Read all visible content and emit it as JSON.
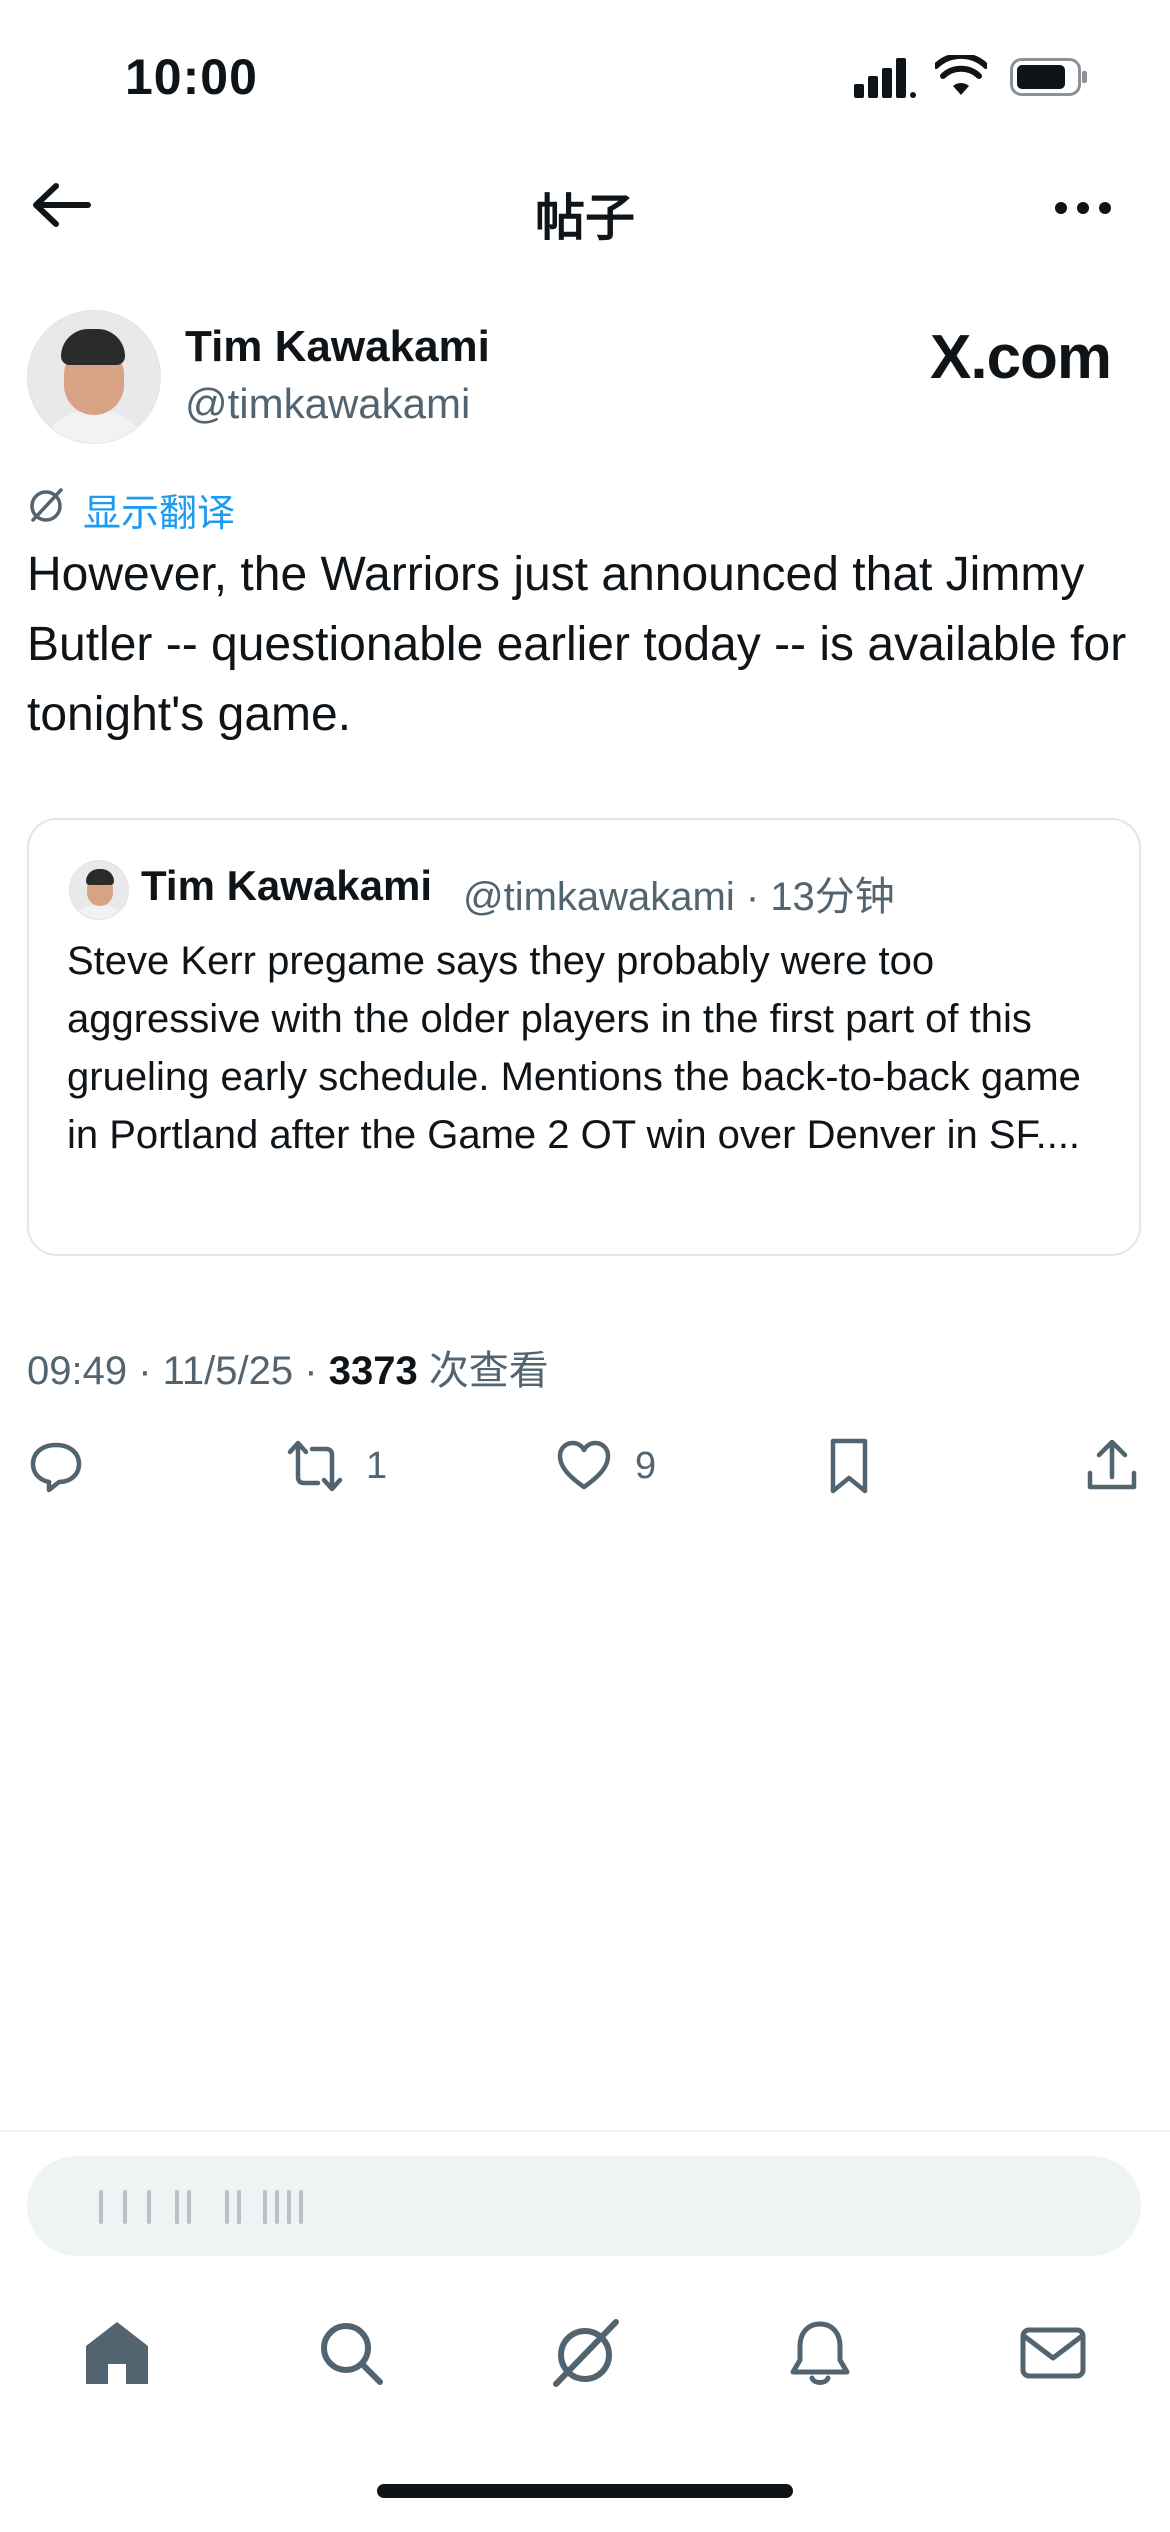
{
  "status_bar": {
    "time": "10:00"
  },
  "header": {
    "title": "帖子"
  },
  "tweet": {
    "author_name": "Tim Kawakami",
    "author_handle": "@timkawakami",
    "source_badge": "X.com",
    "translate_label": "显示翻译",
    "text": "However, the Warriors just announced that Jimmy Butler -- questionable earlier today -- is available for tonight's game.",
    "time": "09:49",
    "date": "11/5/25",
    "views_count": "3373",
    "views_label": "次查看",
    "retweets": "1",
    "likes": "9"
  },
  "quote": {
    "author_name": "Tim Kawakami",
    "author_handle": "@timkawakami",
    "time_ago": "13分钟",
    "text": "Steve Kerr pregame says they probably were too aggressive with the older players in the first part of this grueling early schedule. Mentions the back-to-back game in Portland after the Game 2 OT win over Denver in SF...."
  },
  "colors": {
    "accent": "#1d9bf0",
    "text": "#0f1419",
    "secondary": "#536471",
    "border": "#e1e6ea"
  },
  "icons": {
    "back": "arrow-left-icon",
    "more": "ellipsis-icon",
    "translate": "grok-icon",
    "reply": "reply-icon",
    "retweet": "retweet-icon",
    "like": "heart-icon",
    "bookmark": "bookmark-icon",
    "share": "share-icon",
    "home": "home-icon",
    "search": "search-icon",
    "grok": "grok-icon",
    "notifications": "bell-icon",
    "messages": "mail-icon"
  }
}
